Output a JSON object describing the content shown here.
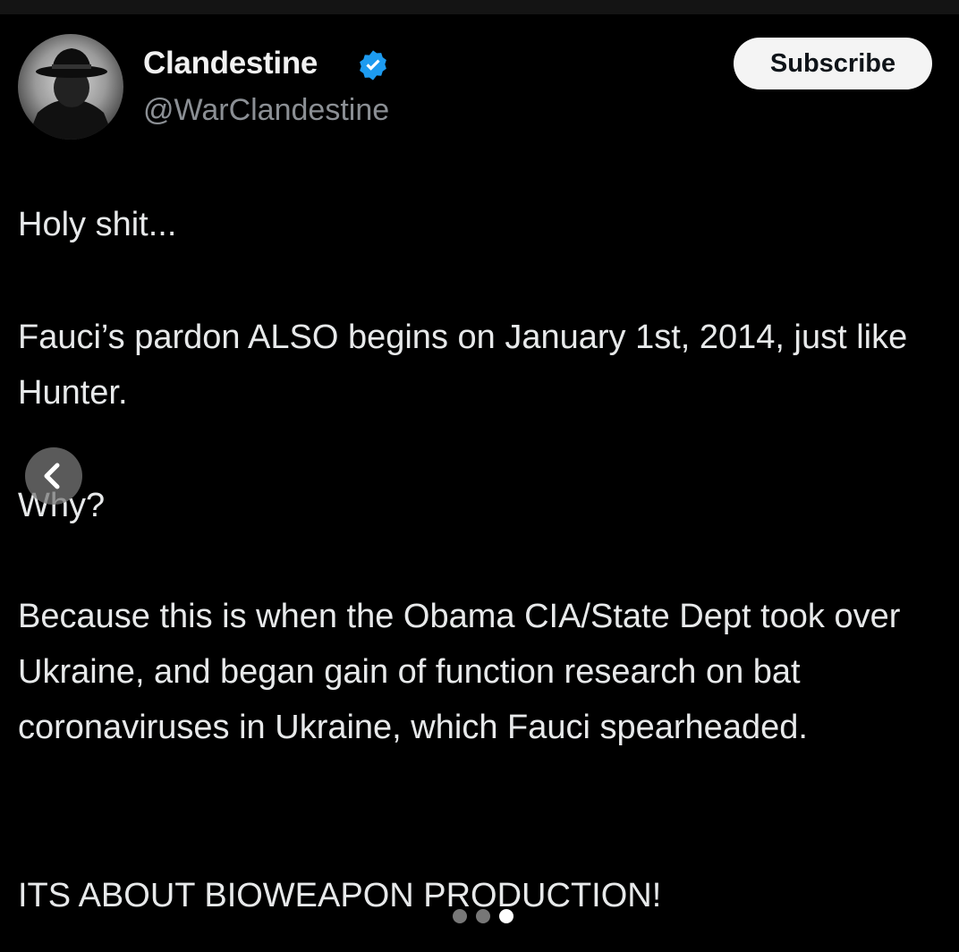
{
  "post": {
    "author": {
      "display_name": "Clandestine",
      "handle": "@WarClandestine",
      "verified": true,
      "avatar_icon": "hat-figure-avatar",
      "verified_icon": "verified-badge-icon",
      "verified_color": "#1d9bf0"
    },
    "subscribe_label": "Subscribe",
    "paragraphs": [
      "Holy shit...",
      "Fauci’s pardon ALSO begins on January 1st, 2014, just like Hunter.",
      "Why?",
      "Because this is when the Obama CIA/State Dept took over Ukraine, and began gain of function research on bat coronaviruses in Ukraine, which Fauci spearheaded.",
      "ITS ABOUT BIOWEAPON PRODUCTION!"
    ]
  },
  "carousel": {
    "prev_icon": "chevron-left-icon",
    "total_slides": 3,
    "active_slide": 3
  },
  "colors": {
    "background": "#000000",
    "text": "#e7e9ea",
    "handle": "#8b8f94",
    "subscribe_bg": "#f4f4f4"
  }
}
